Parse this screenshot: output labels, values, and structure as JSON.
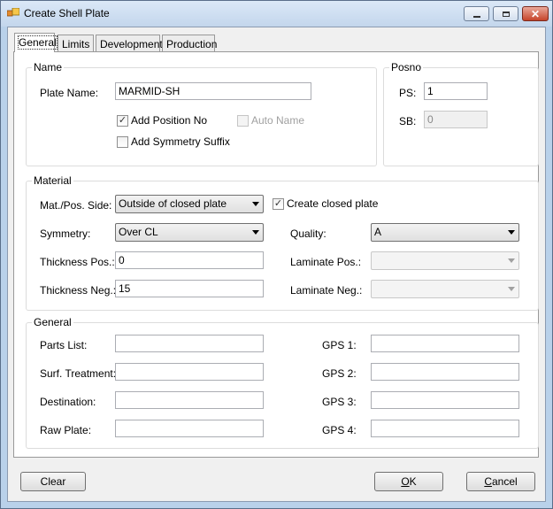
{
  "window": {
    "title": "Create Shell Plate"
  },
  "tabs": [
    {
      "label": "General",
      "active": true
    },
    {
      "label": "Limits",
      "active": false
    },
    {
      "label": "Development",
      "active": false
    },
    {
      "label": "Production",
      "active": false
    }
  ],
  "name_group": {
    "title": "Name",
    "plate_name_label": "Plate Name:",
    "plate_name_value": "MARMID-SH",
    "add_position_no": {
      "label": "Add Position No",
      "checked": true
    },
    "auto_name": {
      "label": "Auto Name",
      "checked": false,
      "disabled": true
    },
    "add_symmetry_suffix": {
      "label": "Add Symmetry Suffix",
      "checked": false
    }
  },
  "posno_group": {
    "title": "Posno",
    "ps_label": "PS:",
    "ps_value": "1",
    "sb_label": "SB:",
    "sb_value": "0"
  },
  "material_group": {
    "title": "Material",
    "mat_pos_side_label": "Mat./Pos. Side:",
    "mat_pos_side_value": "Outside of closed plate",
    "create_closed_plate": {
      "label": "Create closed plate",
      "checked": true
    },
    "symmetry_label": "Symmetry:",
    "symmetry_value": "Over CL",
    "quality_label": "Quality:",
    "quality_value": "A",
    "thickness_pos_label": "Thickness Pos.:",
    "thickness_pos_value": "0",
    "laminate_pos_label": "Laminate Pos.:",
    "laminate_pos_value": "",
    "thickness_neg_label": "Thickness Neg.:",
    "thickness_neg_value": "15",
    "laminate_neg_label": "Laminate Neg.:",
    "laminate_neg_value": ""
  },
  "general_group": {
    "title": "General",
    "parts_list_label": "Parts List:",
    "parts_list_value": "",
    "surf_treatment_label": "Surf. Treatment:",
    "surf_treatment_value": "",
    "destination_label": "Destination:",
    "destination_value": "",
    "raw_plate_label": "Raw Plate:",
    "raw_plate_value": "",
    "gps1_label": "GPS 1:",
    "gps1_value": "",
    "gps2_label": "GPS 2:",
    "gps2_value": "",
    "gps3_label": "GPS 3:",
    "gps3_value": "",
    "gps4_label": "GPS 4:",
    "gps4_value": ""
  },
  "buttons": {
    "clear": "Clear",
    "ok_mnemonic": "O",
    "ok_rest": "K",
    "cancel_mnemonic": "C",
    "cancel_rest": "ancel"
  },
  "icons": [
    "app-icon",
    "minimize-icon",
    "maximize-icon",
    "close-icon",
    "check-icon",
    "dropdown-arrow-icon"
  ]
}
